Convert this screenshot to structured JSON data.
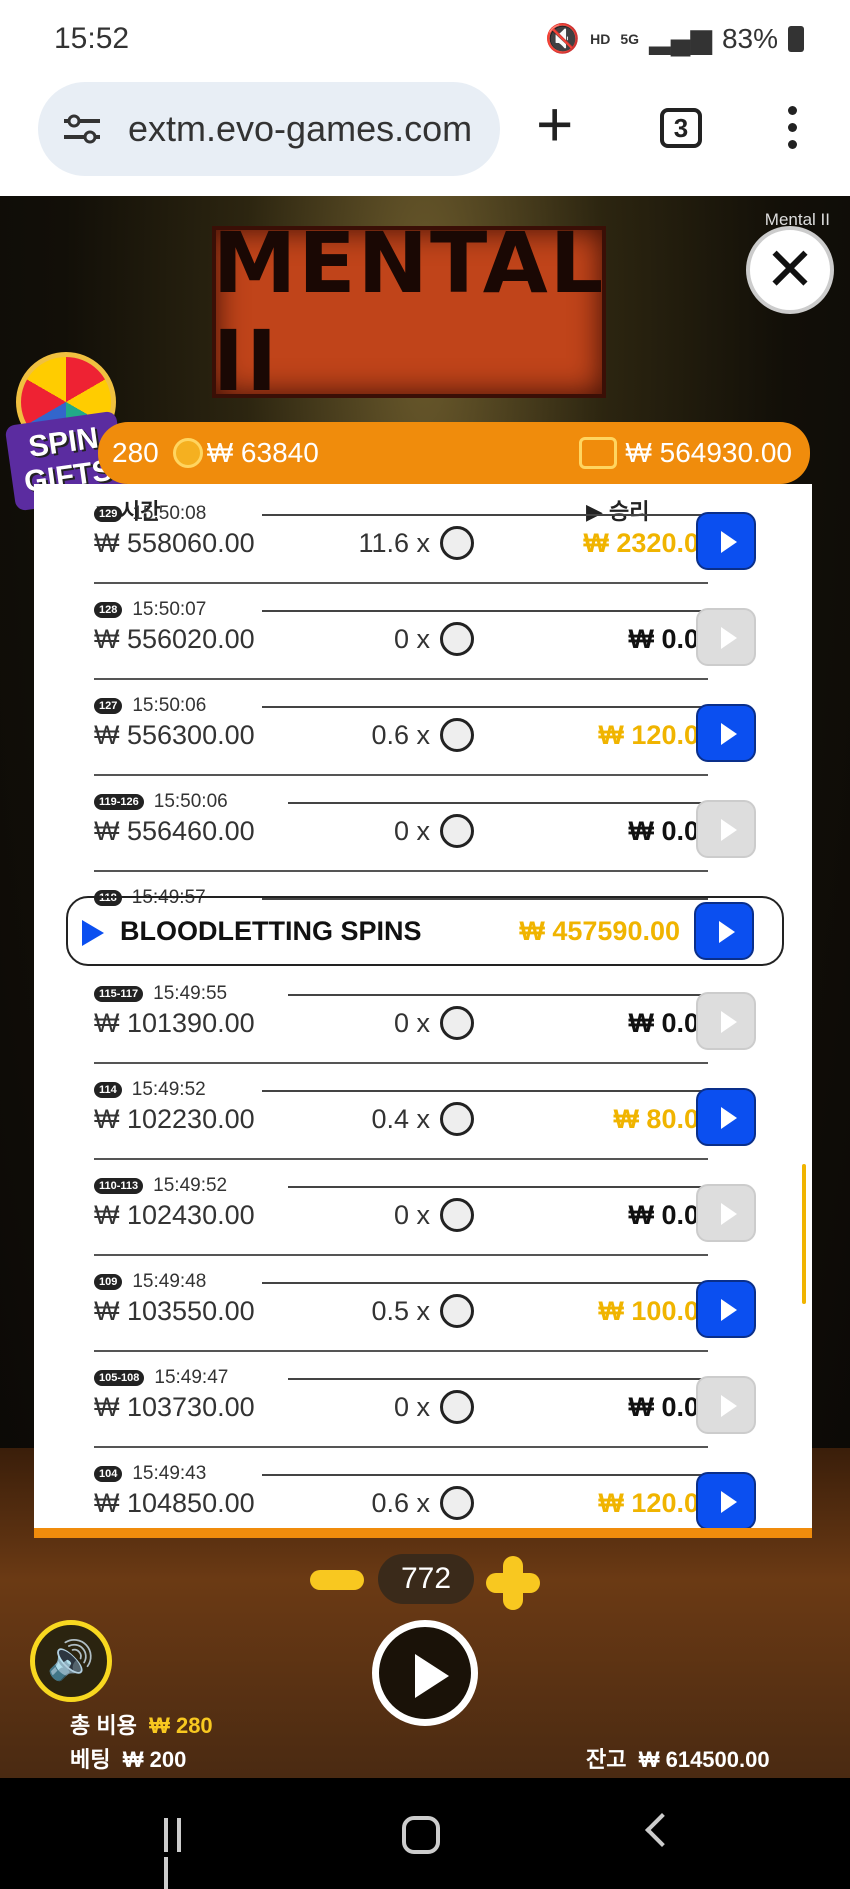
{
  "status_bar": {
    "time": "15:52",
    "hd_label": "HD",
    "net_label": "5G",
    "battery": "83%"
  },
  "browser": {
    "url": "extm.evo-games.com",
    "tab_count": "3"
  },
  "game": {
    "logo_text": "MENTAL II",
    "brand": "Mental II",
    "promo": "SPIN GIFTS",
    "info": {
      "cost": "280",
      "coins": "₩ 63840",
      "balance": "₩ 564930.00"
    },
    "history": {
      "col_time": "시간",
      "col_win": "승리",
      "rows": [
        {
          "badge": "129",
          "time": "15:50:08",
          "balance": "₩ 558060.00",
          "mult": "11.6 x",
          "win": "₩ 2320.00",
          "state": "gold"
        },
        {
          "badge": "128",
          "time": "15:50:07",
          "balance": "₩ 556020.00",
          "mult": "0 x",
          "win": "₩ 0.00",
          "state": "zero"
        },
        {
          "badge": "127",
          "time": "15:50:06",
          "balance": "₩ 556300.00",
          "mult": "0.6 x",
          "win": "₩ 120.00",
          "state": "gold"
        },
        {
          "badge": "119-126",
          "time": "15:50:06",
          "balance": "₩ 556460.00",
          "mult": "0 x",
          "win": "₩ 0.00",
          "state": "zero"
        },
        {
          "badge": "118",
          "time": "15:49:57",
          "bonus_title": "BLOODLETTING SPINS",
          "win": "₩ 457590.00",
          "state": "bonus"
        },
        {
          "badge": "115-117",
          "time": "15:49:55",
          "balance": "₩ 101390.00",
          "mult": "0 x",
          "win": "₩ 0.00",
          "state": "zero"
        },
        {
          "badge": "114",
          "time": "15:49:52",
          "balance": "₩ 102230.00",
          "mult": "0.4 x",
          "win": "₩ 80.00",
          "state": "gold"
        },
        {
          "badge": "110-113",
          "time": "15:49:52",
          "balance": "₩ 102430.00",
          "mult": "0 x",
          "win": "₩ 0.00",
          "state": "zero"
        },
        {
          "badge": "109",
          "time": "15:49:48",
          "balance": "₩ 103550.00",
          "mult": "0.5 x",
          "win": "₩ 100.00",
          "state": "gold"
        },
        {
          "badge": "105-108",
          "time": "15:49:47",
          "balance": "₩ 103730.00",
          "mult": "0 x",
          "win": "₩ 0.00",
          "state": "zero"
        },
        {
          "badge": "104",
          "time": "15:49:43",
          "balance": "₩ 104850.00",
          "mult": "0.6 x",
          "win": "₩ 120.00",
          "state": "gold"
        }
      ]
    },
    "controls": {
      "bet_count": "772",
      "total_cost_label": "총 비용",
      "total_cost_value": "₩ 280",
      "bet_label": "베팅",
      "bet_value": "₩ 200",
      "balance_label": "잔고",
      "balance_value": "₩ 614500.00"
    }
  }
}
